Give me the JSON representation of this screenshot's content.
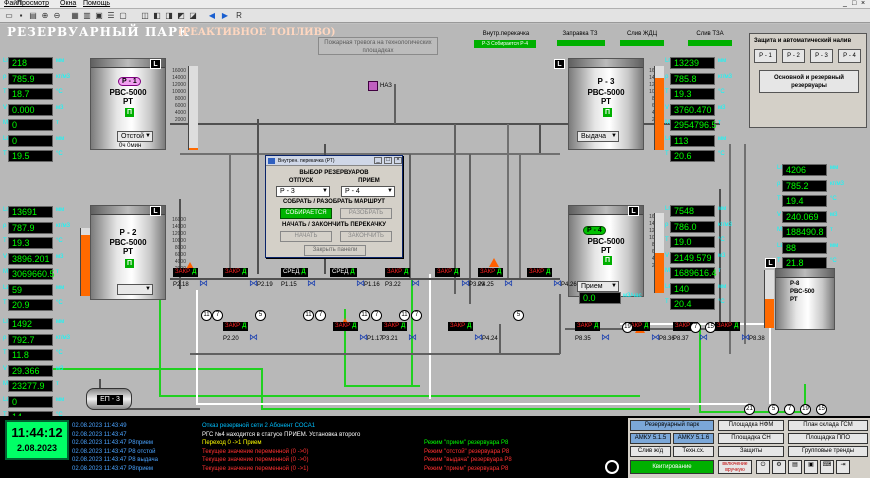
{
  "menu": [
    "Файл",
    "Просмотр",
    "Окна",
    "Помощь"
  ],
  "window_controls": [
    "_",
    "□",
    "×"
  ],
  "toolbar_icons": [
    "open-icon",
    "save-icon",
    "print-icon",
    "zoom-in-icon",
    "zoom-out-icon",
    "grid-icon",
    "chart-icon",
    "back-icon",
    "forward-icon",
    "refresh-icon",
    "R"
  ],
  "header": {
    "title": "РЕЗЕРВУАРНЫЙ ПАРК",
    "subtitle": "(РЕАКТИВНОЕ ТОПЛИВО)",
    "note": "Пожарная тревога на технологических площадках"
  },
  "top_cells": [
    {
      "label": "Внутр.перекачка",
      "chip": "Р-3 Собирается Р-4"
    },
    {
      "label": "Заправка ТЗ",
      "chip": ""
    },
    {
      "label": "Слив ЖДЦ",
      "chip": ""
    },
    {
      "label": "Слив ТЗА",
      "chip": ""
    }
  ],
  "panels": {
    "p1": {
      "rows": [
        {
          "lbl": "Lг",
          "val": "218",
          "unit": "мм"
        },
        {
          "lbl": "ρ",
          "val": "785.9",
          "unit": "кг/м3"
        },
        {
          "lbl": "T",
          "val": "18.7",
          "unit": "°C"
        },
        {
          "lbl": "V",
          "val": "0.000",
          "unit": "м3"
        },
        {
          "lbl": "M",
          "val": "0",
          "unit": "т"
        },
        {
          "lbl": "Lв",
          "val": "0",
          "unit": "мм"
        },
        {
          "lbl": "T",
          "val": "19.5",
          "unit": "°C"
        }
      ]
    },
    "p2": {
      "rows": [
        {
          "lbl": "Lг",
          "val": "13691",
          "unit": "мм"
        },
        {
          "lbl": "ρ",
          "val": "787.9",
          "unit": "кг/м3"
        },
        {
          "lbl": "T",
          "val": "19.3",
          "unit": "°C"
        },
        {
          "lbl": "V",
          "val": "3896.201",
          "unit": "м3"
        },
        {
          "lbl": "M",
          "val": "3069660.5",
          "unit": "т"
        },
        {
          "lbl": "Lв",
          "val": "59",
          "unit": "мм"
        },
        {
          "lbl": "T",
          "val": "20.9",
          "unit": "°C"
        }
      ]
    },
    "p3": {
      "rows": [
        {
          "lbl": "Lг",
          "val": "13239",
          "unit": "мм"
        },
        {
          "lbl": "ρ",
          "val": "785.8",
          "unit": "кг/м3"
        },
        {
          "lbl": "T",
          "val": "19.3",
          "unit": "°C"
        },
        {
          "lbl": "V",
          "val": "3760.470",
          "unit": "м3"
        },
        {
          "lbl": "M",
          "val": "2954796.5",
          "unit": "т"
        },
        {
          "lbl": "Lв",
          "val": "113",
          "unit": "мм"
        },
        {
          "lbl": "T",
          "val": "20.6",
          "unit": "°C"
        }
      ]
    },
    "p4": {
      "rows": [
        {
          "lbl": "Lг",
          "val": "7548",
          "unit": "мм"
        },
        {
          "lbl": "ρ",
          "val": "786.0",
          "unit": "кг/м3"
        },
        {
          "lbl": "T",
          "val": "19.0",
          "unit": "°C"
        },
        {
          "lbl": "V",
          "val": "2149.579",
          "unit": "м3"
        },
        {
          "lbl": "M",
          "val": "1689616.4",
          "unit": "т"
        },
        {
          "lbl": "Lв",
          "val": "140",
          "unit": "мм"
        },
        {
          "lbl": "T",
          "val": "20.4",
          "unit": "°C"
        }
      ]
    },
    "p5": {
      "rows": [
        {
          "lbl": "Lг",
          "val": "1492",
          "unit": "мм"
        },
        {
          "lbl": "ρ",
          "val": "792.7",
          "unit": "кг/м3"
        },
        {
          "lbl": "T",
          "val": "11.8",
          "unit": "°C"
        },
        {
          "lbl": "V",
          "val": "29.366",
          "unit": "м3"
        },
        {
          "lbl": "M",
          "val": "23277.9",
          "unit": "т"
        },
        {
          "lbl": "Lв",
          "val": "0",
          "unit": "мм"
        },
        {
          "lbl": "T",
          "val": "14",
          "unit": "°C"
        }
      ]
    },
    "p8": {
      "rows": [
        {
          "lbl": "Lг",
          "val": "4206",
          "unit": "мм"
        },
        {
          "lbl": "ρ",
          "val": "785.2",
          "unit": "кг/м3"
        },
        {
          "lbl": "T",
          "val": "19.4",
          "unit": "°C"
        },
        {
          "lbl": "V",
          "val": "240.069",
          "unit": "м3"
        },
        {
          "lbl": "M",
          "val": "188490.8",
          "unit": "т"
        },
        {
          "lbl": "Lв",
          "val": "88",
          "unit": "мм"
        },
        {
          "lbl": "T",
          "val": "21.8",
          "unit": "°C"
        }
      ]
    }
  },
  "tanks": {
    "t1": {
      "name": "Р - 1",
      "model": "РВС-5000",
      "unit": "РТ",
      "mode": "Отстой",
      "foot": "0ч 0мин",
      "fill": 0.02
    },
    "t2": {
      "name": "Р - 2",
      "model": "РВС-5000",
      "unit": "РТ",
      "mode": "",
      "foot": "",
      "fill": 0.9
    },
    "t3": {
      "name": "Р - 3",
      "model": "РВС-5000",
      "unit": "РТ",
      "mode": "Выдача",
      "foot": "",
      "fill": 0.86
    },
    "t4": {
      "name": "Р - 4",
      "model": "РВС-5000",
      "unit": "РТ",
      "mode": "Прием",
      "foot": "0.0",
      "foot_unit": "м3/час",
      "fill": 0.5
    },
    "t8": {
      "name": "Р-8",
      "model": "РВС-500",
      "unit": "РТ",
      "fill": 0.5
    },
    "ez": {
      "name": "ЕП - 3"
    }
  },
  "scale_ticks": [
    "16000",
    "14000",
    "12000",
    "10000",
    "8000",
    "6000",
    "4000",
    "2000"
  ],
  "naz_label": "НАЗ",
  "dialog": {
    "title": "Внутрен. перекачка (РТ)",
    "heading": "ВЫБОР РЕЗЕРВУАРОВ",
    "col_from": "ОТПУСК",
    "col_to": "ПРИЕМ",
    "from_value": "Р - 3",
    "to_value": "Р - 4",
    "route_label": "СОБРАТЬ / РАЗОБРАТЬ МАРШРУТ",
    "btn_assembling": "СОБИРАЕТСЯ",
    "btn_disassemble": "РАЗОБРАТЬ",
    "pump_label": "НАЧАТЬ / ЗАКОНЧИТЬ ПЕРЕКАЧКУ",
    "btn_start": "НАЧАТЬ",
    "btn_finish": "ЗАКОНЧИТЬ",
    "btn_close": "Закрыть панели"
  },
  "protection": {
    "heading": "Защита и автоматический налив",
    "buttons": [
      "Р - 1",
      "Р - 2",
      "Р - 3",
      "Р - 4"
    ],
    "big": "Основной и резервный резервуары"
  },
  "valves": [
    {
      "label": "P2.18",
      "state": "ЗАКР",
      "mark": "Д"
    },
    {
      "label": "P2.19",
      "state": "ЗАКР",
      "mark": "Д"
    },
    {
      "label": "P1.15",
      "state": "СРЕД",
      "mark": "Д"
    },
    {
      "label": "P1.16",
      "state": "СРЕД",
      "mark": "Д"
    },
    {
      "label": "P3.22",
      "state": "ЗАКР",
      "mark": "Д"
    },
    {
      "label": "P3.23",
      "state": "ЗАКР",
      "mark": "Д"
    },
    {
      "label": "P4.25",
      "state": "ЗАКР",
      "mark": "Д"
    },
    {
      "label": "P4.26",
      "state": "ЗАКР",
      "mark": "Д"
    },
    {
      "label": "P2.20",
      "state": "ЗАКР",
      "mark": "Д"
    },
    {
      "label": "P1.17",
      "state": "ЗАКР",
      "mark": "Д"
    },
    {
      "label": "P3.21",
      "state": "ЗАКР",
      "mark": "Д"
    },
    {
      "label": "P4.24",
      "state": "ЗАКР",
      "mark": "Д"
    },
    {
      "label": "P8.35",
      "state": "ЗАКР",
      "mark": "Д"
    },
    {
      "label": "P8.36",
      "state": "ЗАКР",
      "mark": "Д"
    },
    {
      "label": "P8.37",
      "state": "ЗАКР",
      "mark": "Д"
    },
    {
      "label": "P8.38",
      "state": "ЗАКР",
      "mark": "Д"
    }
  ],
  "line_numbers": [
    "11",
    "7",
    "5",
    "11",
    "7",
    "11",
    "7",
    "11",
    "7",
    "5",
    "19",
    "7",
    "15",
    "21",
    "5",
    "7",
    "19",
    "15"
  ],
  "clock": {
    "time": "11:44:12",
    "date": "2.08.2023"
  },
  "log": [
    {
      "ts": "02.08.2023 11:43:49",
      "msg": "Отказ резервной сети  2  Абонент СОСА1",
      "msg2": "",
      "color": "#00c0ff",
      "color2": "#00c0ff"
    },
    {
      "ts": "02.08.2023 11:43:47",
      "msg": "РГС №4  находится в статусе ПРИЕМ. Установка второго",
      "msg2": "",
      "color": "#ffffff",
      "color2": "#ffffff"
    },
    {
      "ts": "02.08.2023 11:43:47 P8прием",
      "msg": "Переход  0 ->1   Прием",
      "msg2": "Режим \"прием\" резервуара Р8",
      "color": "#ffff00",
      "color2": "#00ff00"
    },
    {
      "ts": "02.08.2023 11:43:47 P8 отстой",
      "msg": "Текущее значение переменной (0 ->0)",
      "msg2": "Режим \"отстой\" резервуара Р8",
      "color": "#ff3030",
      "color2": "#ff3030"
    },
    {
      "ts": "02.08.2023 11:43:47 P8 выдача",
      "msg": "Текущее значение переменной (0 ->0)",
      "msg2": "Режим \"выдача\" резервуара Р8",
      "color": "#ff3030",
      "color2": "#ff3030"
    },
    {
      "ts": "02.08.2023 11:43:47 P8прием",
      "msg": "Текущее значение переменной (0 ->1)",
      "msg2": "Режим \"прием\" резервуара Р8",
      "color": "#ff3030",
      "color2": "#ff3030"
    }
  ],
  "nav": {
    "rezerv_park": "Резервуарный парк",
    "pl_nfm": "Площадка НФМ",
    "plan_gsm": "План склада ГСМ",
    "amku515": "АМКУ 5.1.5",
    "amku516": "АМКУ 5.1.6",
    "pl_sn": "Площадка СН",
    "pl_ppo": "Площадка ППО",
    "sliv": "Слив ж/д",
    "tehsh": "Техн.сх.",
    "zashity": "Защиты",
    "gruppy": "Групповые тренды",
    "kvit": "Квитирование",
    "vkl": "включение вручную"
  }
}
